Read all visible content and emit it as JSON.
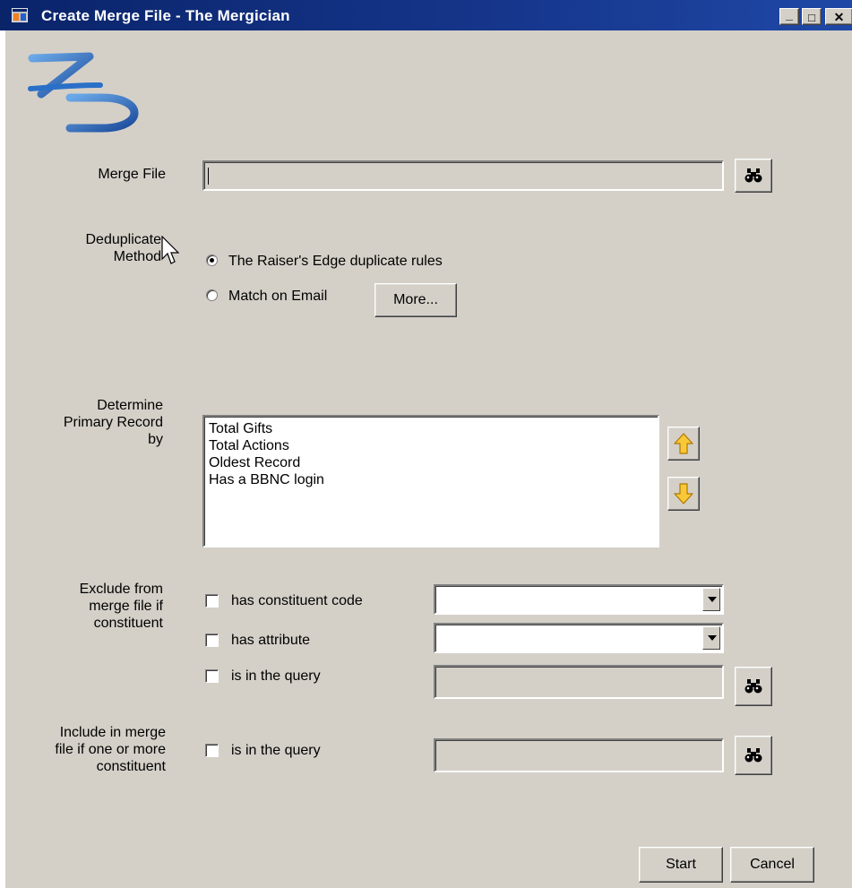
{
  "window": {
    "title": "Create Merge File - The Mergician",
    "minimize_glyph": "_",
    "maximize_glyph": "□",
    "close_glyph": "✕"
  },
  "logo": {
    "text": "ZD"
  },
  "merge_file": {
    "label": "Merge File",
    "value": "",
    "browse_icon": "binoculars-icon"
  },
  "dedupe": {
    "label_line1": "Deduplicate",
    "label_line2": "Method",
    "option_re": "The Raiser's Edge duplicate rules",
    "option_email": "Match on Email",
    "selected": "option_re",
    "more_button": "More..."
  },
  "primary": {
    "label_line1": "Determine",
    "label_line2": "Primary Record",
    "label_line3": "by",
    "items": [
      "Total Gifts",
      "Total Actions",
      "Oldest Record",
      "Has a BBNC login"
    ],
    "up_icon": "arrow-up-icon",
    "down_icon": "arrow-down-icon"
  },
  "exclude": {
    "label_line1": "Exclude from",
    "label_line2": "merge file if",
    "label_line3": "constituent",
    "constituent_code": "has constituent code",
    "attribute": "has attribute",
    "in_query": "is in the query"
  },
  "include": {
    "label_line1": "Include in merge",
    "label_line2": "file if one or more",
    "label_line3": "constituent",
    "in_query": "is in the query"
  },
  "buttons": {
    "start": "Start",
    "cancel": "Cancel"
  },
  "colors": {
    "titlebar": "#0a246a",
    "face": "#d4d0c8",
    "accent_arrow": "#f8c838"
  }
}
